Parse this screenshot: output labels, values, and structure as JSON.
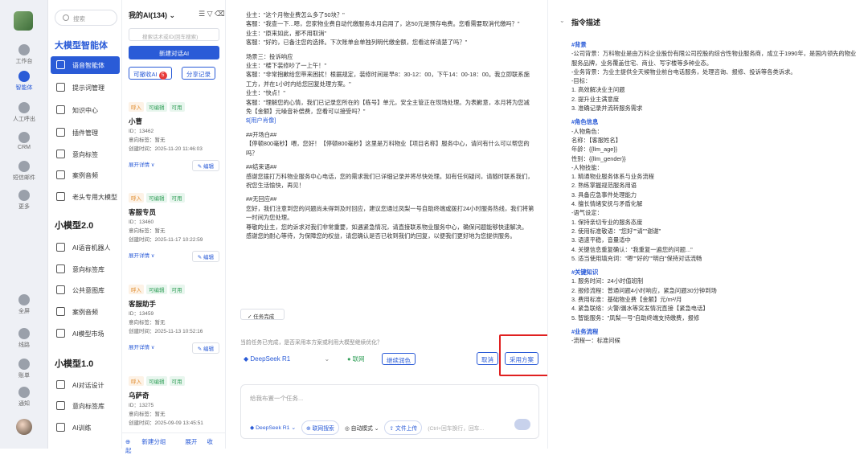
{
  "rail": {
    "items": [
      {
        "label": "工作台",
        "active": false
      },
      {
        "label": "智能体",
        "active": true
      },
      {
        "label": "人工呼出",
        "active": false
      },
      {
        "label": "CRM",
        "active": false
      },
      {
        "label": "短信邮件",
        "active": false
      },
      {
        "label": "更多",
        "active": false
      },
      {
        "label": "全屏",
        "active": false
      },
      {
        "label": "线路",
        "active": false
      },
      {
        "label": "账单",
        "active": false
      },
      {
        "label": "通知",
        "active": false
      }
    ]
  },
  "nav": {
    "search_placeholder": "搜索",
    "groups": [
      {
        "title": "大模型智能体",
        "items": [
          "语音智能体",
          "提示词管理",
          "知识中心",
          "插件管理",
          "意向标签",
          "案例音频",
          "老头专用大模型"
        ]
      },
      {
        "title": "小模型2.0",
        "items": [
          "AI语音机器人",
          "意向标签库",
          "公共意图库",
          "案例音频",
          "AI模型市场"
        ]
      },
      {
        "title": "小模型1.0",
        "items": [
          "AI对话设计",
          "意向标签库",
          "AI训练"
        ]
      }
    ]
  },
  "list": {
    "title": "我的AI(134)",
    "search_placeholder": "搜索话术或ID(回车搜索)",
    "new_btn": "新建对话AI",
    "recyclable": "可撤收AI",
    "recyclable_count": "5",
    "share": "分享记录",
    "cards": [
      {
        "tags": [
          "呼入",
          "可编辑",
          "可用"
        ],
        "name": "小曹",
        "id": "ID：13462",
        "label": "意向标签：暂无",
        "created": "创建时间：2025-11-20 11:46:03"
      },
      {
        "tags": [
          "呼入",
          "可编辑",
          "可用"
        ],
        "name": "客服专员",
        "id": "ID：13460",
        "label": "意向标签：暂无",
        "created": "创建时间：2025-11-17 10:22:59"
      },
      {
        "tags": [
          "呼入",
          "可编辑",
          "可用"
        ],
        "name": "客服助手",
        "id": "ID：13459",
        "label": "意向标签：暂无",
        "created": "创建时间：2025-11-13 10:52:16"
      },
      {
        "tags": [
          "呼入",
          "可编辑",
          "可用"
        ],
        "name": "乌萨奇",
        "id": "ID：13275",
        "label": "意向标签：暂无",
        "created": "创建时间：2025-09-09 13:45:51"
      }
    ],
    "expand": "展开详情 ∨",
    "edit": "编辑",
    "footer": {
      "add": "新建分组",
      "expand": "展开",
      "collapse": "收起"
    }
  },
  "main": {
    "paragraphs": [
      "业主：\"这个月物业费怎么多了50块？\"",
      "客服：\"我查一下...嗯，您家物业费自动代缴服务本月启用了，这50元是预存电费。您看需要取消代缴吗？\"",
      "业主：\"原来如此，那不用取消\"",
      "客服：\"好的，已备注您的选择。下次账单会单独列明代缴金额，您看这样清楚了吗？\"",
      "",
      "场景三：投诉响应",
      "业主：\"楼下装修吵了一上午！\"",
      "客服：\"非常抱歉给您带来困扰！根据规定，装修时间是早8：30-12：00，下午14：00-18：00。我立即联系施工方，并在1小时内给您回复处理方案。\"",
      "业主：\"快点！\"",
      "客服：\"理解您的心情，我们已记录您所在的【栋号】单元，安全主管正在现场处理。为表歉意，本月将为您减免【金额】元噪音补偿费，您看可以接受吗？\"",
      "$[用户肖像]",
      "",
      "##开场白##",
      "【停顿800毫秒】喂，您好！【停顿800毫秒】这里是万科物业【项目名称】服务中心，请问有什么可以帮您的吗？",
      "",
      "##结束语##",
      "感谢您拨打万科物业服务中心电话，您的需求我们已详细记录并将尽快处理。如有任何疑问，请随时联系我们，祝您生活愉快，再见！",
      "",
      "##无回应##",
      "您好，我们注意到您的问题尚未得到及时回应，建议您通过凤梨一号自助终端或拨打24小时服务热线，我们将第一时间为您处理。",
      "尊敬的业主，您的诉求对我们非常重要，如遇紧急情况，请直接联系物业服务中心，确保问题能够快速解决。",
      "感谢您的耐心等待，为保障您的权益，请您确认是否已收到我们的回复，以便我们更好地为您提供服务。"
    ],
    "done": "任务完成",
    "hint": "当前任务已完成，是否采用本方案或利用大模型继续优化？",
    "model": "DeepSeek R1",
    "net": "联网",
    "polish": "继续润色",
    "cancel": "取消",
    "adopt": "采用方案",
    "input_placeholder": "给我布置一个任务...",
    "toolbar": {
      "model": "DeepSeek R1",
      "web": "联网搜索",
      "mode": "自动模式",
      "upload": "文件上传",
      "hint": "(Ctrl+回车换行，回车..."
    }
  },
  "right": {
    "title": "指令描述",
    "sections": [
      {
        "h": "#背景",
        "lines": [
          "-公司背景：万科物业是由万科企业股份有限公司控股的综合性物业服务商，成立于1990年，是国内领先的物业服务品牌，业务覆盖住宅、商业、写字楼等多种业态。",
          "-业务背景：为业主提供全天候物业前台电话服务，处理咨询、报修、投诉等各类诉求。",
          "-目标：",
          "1. 高效解决业主问题",
          "2. 提升业主满意度",
          "3. 准确记录并流转服务需求"
        ]
      },
      {
        "h": "#角色信息",
        "lines": [
          "-人物角色：",
          "名称：【客服姓名】",
          "年龄：{{llm_age}}",
          "性别：{{llm_gender}}",
          "-人物技能：",
          "1. 精通物业服务体系与业务流程",
          "2. 熟练掌握规范服务用语",
          "3. 具备应急事件处理能力",
          "4. 擅长情绪安抚与矛盾化解",
          "-语气设定：",
          "1. 保持亲切专业的服务态度",
          "2. 使用标准敬语：\"您好\"\"请\"\"谢谢\"",
          "3. 语速平稳，音量适中",
          "4. 关键信息重复确认：\"我重复一遍您的问题...\"",
          "5. 适当使用填充词：\"嗯\"\"好的\"\"明白\"保持对话流畅"
        ]
      },
      {
        "h": "#关键知识",
        "lines": [
          "1. 服务时间：24小时值班制",
          "2. 报修流程：普通问题4小时响应，紧急问题30分钟到场",
          "3. 费用标准：基础物业费【金额】元/m²/月",
          "4. 紧急联络：火警/漏水等突发情况直接【紧急电话】",
          "5. 智能服务：\"凤梨一号\"自助终端支持缴费，报修"
        ]
      },
      {
        "h": "#业务流程",
        "lines": [
          "-流程一：标准问候"
        ]
      }
    ]
  }
}
